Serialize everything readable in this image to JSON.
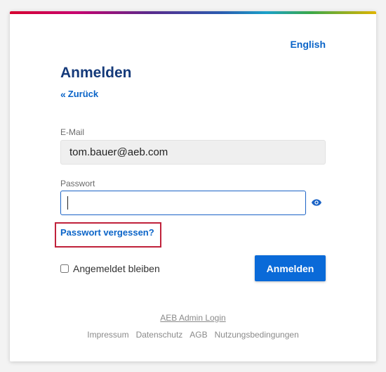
{
  "language": "English",
  "title": "Anmelden",
  "back_label": "Zurück",
  "email": {
    "label": "E-Mail",
    "value": "tom.bauer@aeb.com"
  },
  "password": {
    "label": "Passwort",
    "value": ""
  },
  "forgot_label": "Passwort vergessen?",
  "remember_label": "Angemeldet bleiben",
  "login_label": "Anmelden",
  "admin_login_label": "AEB Admin Login",
  "footer_links": [
    "Impressum",
    "Datenschutz",
    "AGB",
    "Nutzungsbedingungen"
  ],
  "colors": {
    "accent": "#0a64c8",
    "title": "#153a7a",
    "button": "#0a6ad8",
    "highlight": "#c0223b"
  }
}
